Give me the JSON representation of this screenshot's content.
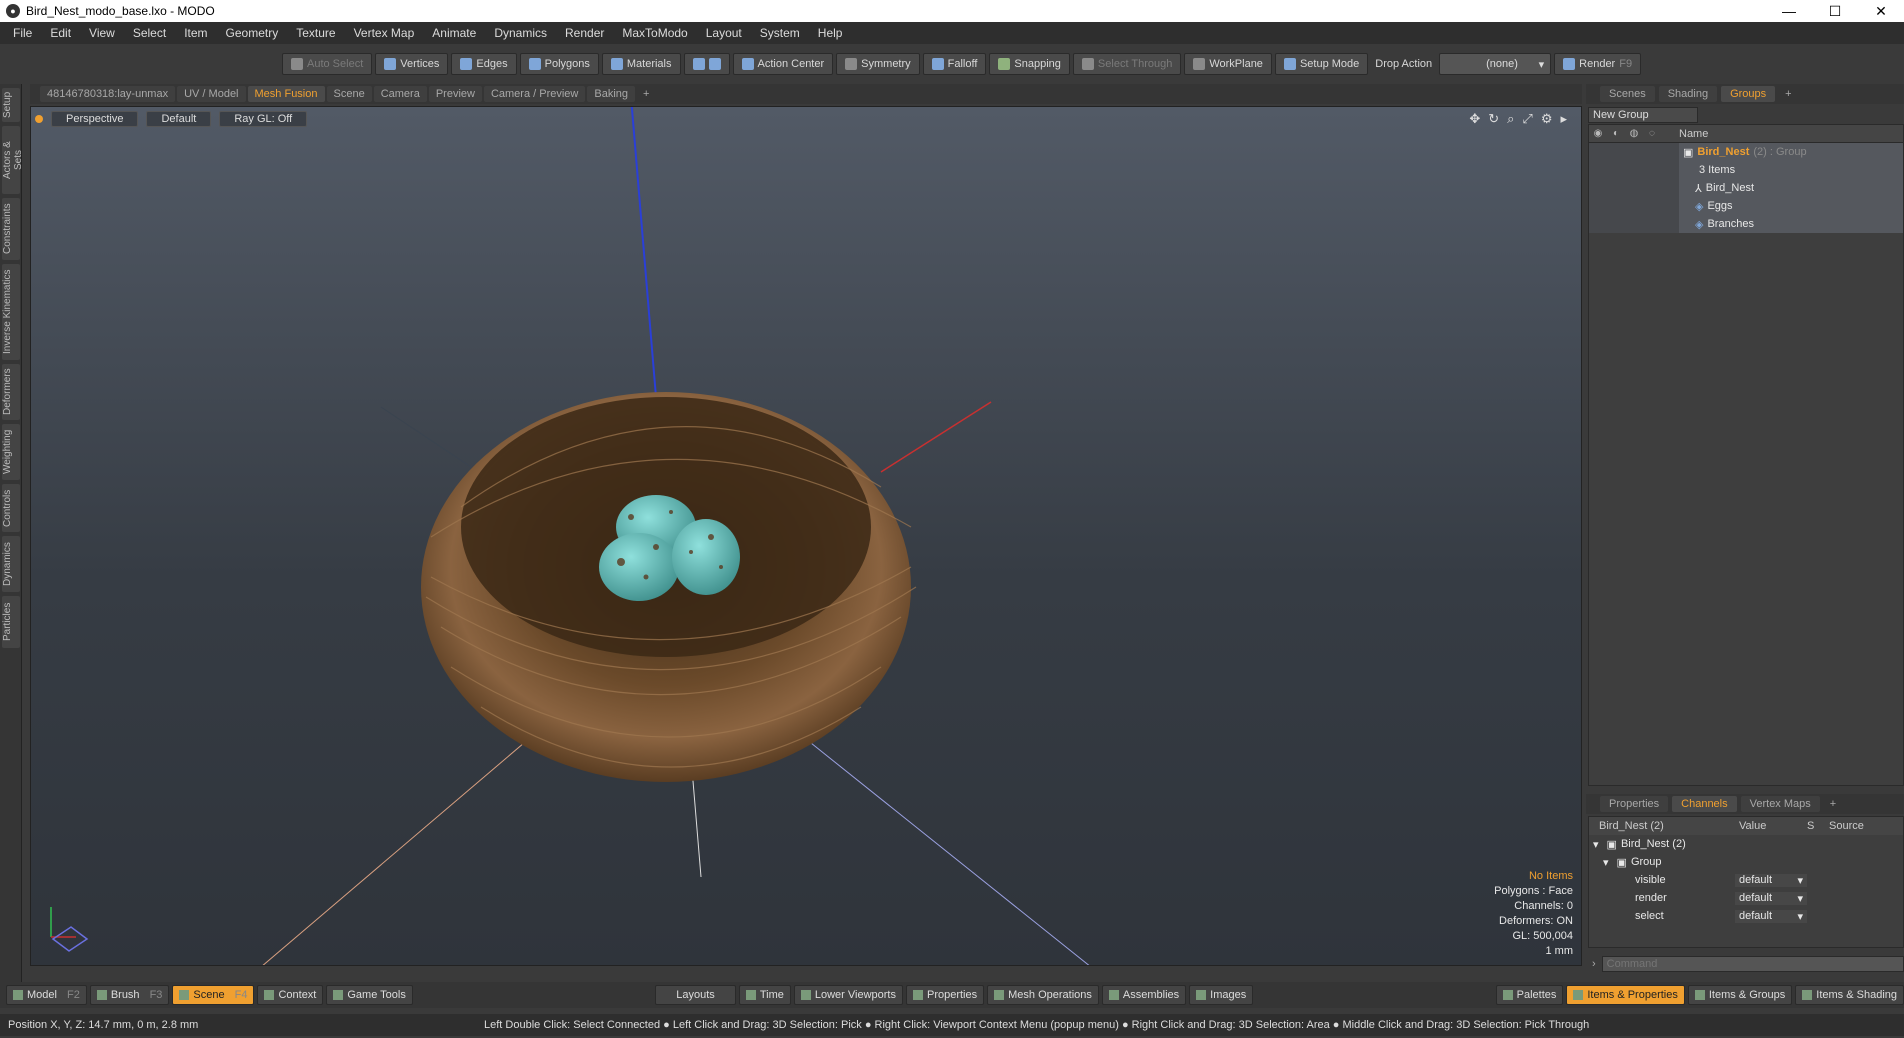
{
  "window": {
    "title": "Bird_Nest_modo_base.lxo - MODO"
  },
  "menu": [
    "File",
    "Edit",
    "View",
    "Select",
    "Item",
    "Geometry",
    "Texture",
    "Vertex Map",
    "Animate",
    "Dynamics",
    "Render",
    "MaxToModo",
    "Layout",
    "System",
    "Help"
  ],
  "toolbar": {
    "auto_select": "Auto Select",
    "vertices": "Vertices",
    "edges": "Edges",
    "polygons": "Polygons",
    "materials": "Materials",
    "action_center": "Action Center",
    "symmetry": "Symmetry",
    "falloff": "Falloff",
    "snapping": "Snapping",
    "select_through": "Select Through",
    "workplane": "WorkPlane",
    "setup_mode": "Setup Mode",
    "drop_action": "Drop Action",
    "drop_value": "(none)",
    "render": "Render",
    "render_key": "F9"
  },
  "left_tabs": [
    "Setup",
    "Actors & Sets",
    "Constraints",
    "Inverse Kinematics",
    "Deformers",
    "Weighting",
    "Controls",
    "Dynamics",
    "Particles"
  ],
  "viewport_tabs": [
    "48146780318:lay-unmax",
    "UV / Model",
    "Mesh Fusion",
    "Scene",
    "Camera",
    "Preview",
    "Camera / Preview",
    "Baking"
  ],
  "viewport_active_tab": "Mesh Fusion",
  "viewport": {
    "perspective": "Perspective",
    "shading": "Default",
    "raygl": "Ray GL: Off",
    "info": {
      "items": "No Items",
      "polygons": "Polygons : Face",
      "channels": "Channels: 0",
      "deformers": "Deformers: ON",
      "gl": "GL: 500,004",
      "unit": "1 mm"
    }
  },
  "right_tabs": [
    "Scenes",
    "Shading",
    "Groups"
  ],
  "right_active_tab": "Groups",
  "groups": {
    "new_group": "New Group",
    "name_header": "Name",
    "root_name": "Bird_Nest",
    "root_suffix": "(2) : Group",
    "root_count": "3 Items",
    "children": [
      "Bird_Nest",
      "Eggs",
      "Branches"
    ]
  },
  "channel_tabs": [
    "Properties",
    "Channels",
    "Vertex Maps"
  ],
  "channel_active_tab": "Channels",
  "channels": {
    "header_name": "Bird_Nest (2)",
    "header_value": "Value",
    "header_s": "S",
    "header_source": "Source",
    "root": "Bird_Nest (2)",
    "group": "Group",
    "rows": [
      {
        "name": "visible",
        "value": "default"
      },
      {
        "name": "render",
        "value": "default"
      },
      {
        "name": "select",
        "value": "default"
      }
    ]
  },
  "command_placeholder": "Command",
  "bottombar": {
    "model": "Model",
    "model_key": "F2",
    "brush": "Brush",
    "brush_key": "F3",
    "scene": "Scene",
    "scene_key": "F4",
    "context": "Context",
    "game_tools": "Game Tools",
    "layouts": "Layouts",
    "time": "Time",
    "lower_viewports": "Lower Viewports",
    "properties": "Properties",
    "mesh_operations": "Mesh Operations",
    "assemblies": "Assemblies",
    "images": "Images",
    "palettes": "Palettes",
    "items_properties": "Items & Properties",
    "items_groups": "Items & Groups",
    "items_shading": "Items & Shading"
  },
  "status": {
    "position": "Position X, Y, Z:   14.7 mm, 0 m, 2.8 mm",
    "hint": "Left Double Click: Select Connected ● Left Click and Drag: 3D Selection: Pick ● Right Click: Viewport Context Menu (popup menu) ● Right Click and Drag: 3D Selection: Area ● Middle Click and Drag: 3D Selection: Pick Through"
  },
  "colors": {
    "accent": "#f0a030",
    "egg": "#5fb8b4",
    "nest": "#6b4a2a"
  }
}
